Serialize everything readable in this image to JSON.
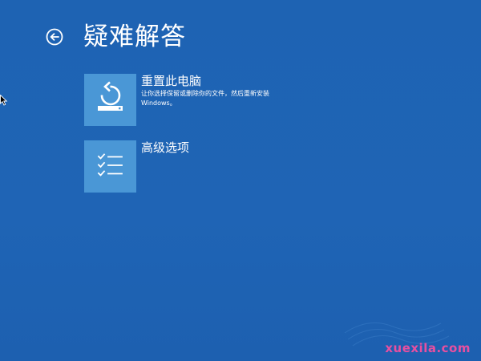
{
  "page": {
    "title": "疑难解答"
  },
  "options": [
    {
      "title": "重置此电脑",
      "description": "让你选择保留或删除你的文件，然后重新安装 Windows。",
      "icon": "reset-pc-icon"
    },
    {
      "title": "高级选项",
      "description": "",
      "icon": "checklist-icon"
    }
  ],
  "watermark": {
    "text": "xuexila.com",
    "color": "#e94fa0"
  },
  "colors": {
    "background": "#1f64b4",
    "tile": "#4a97d6",
    "text": "#ffffff"
  }
}
